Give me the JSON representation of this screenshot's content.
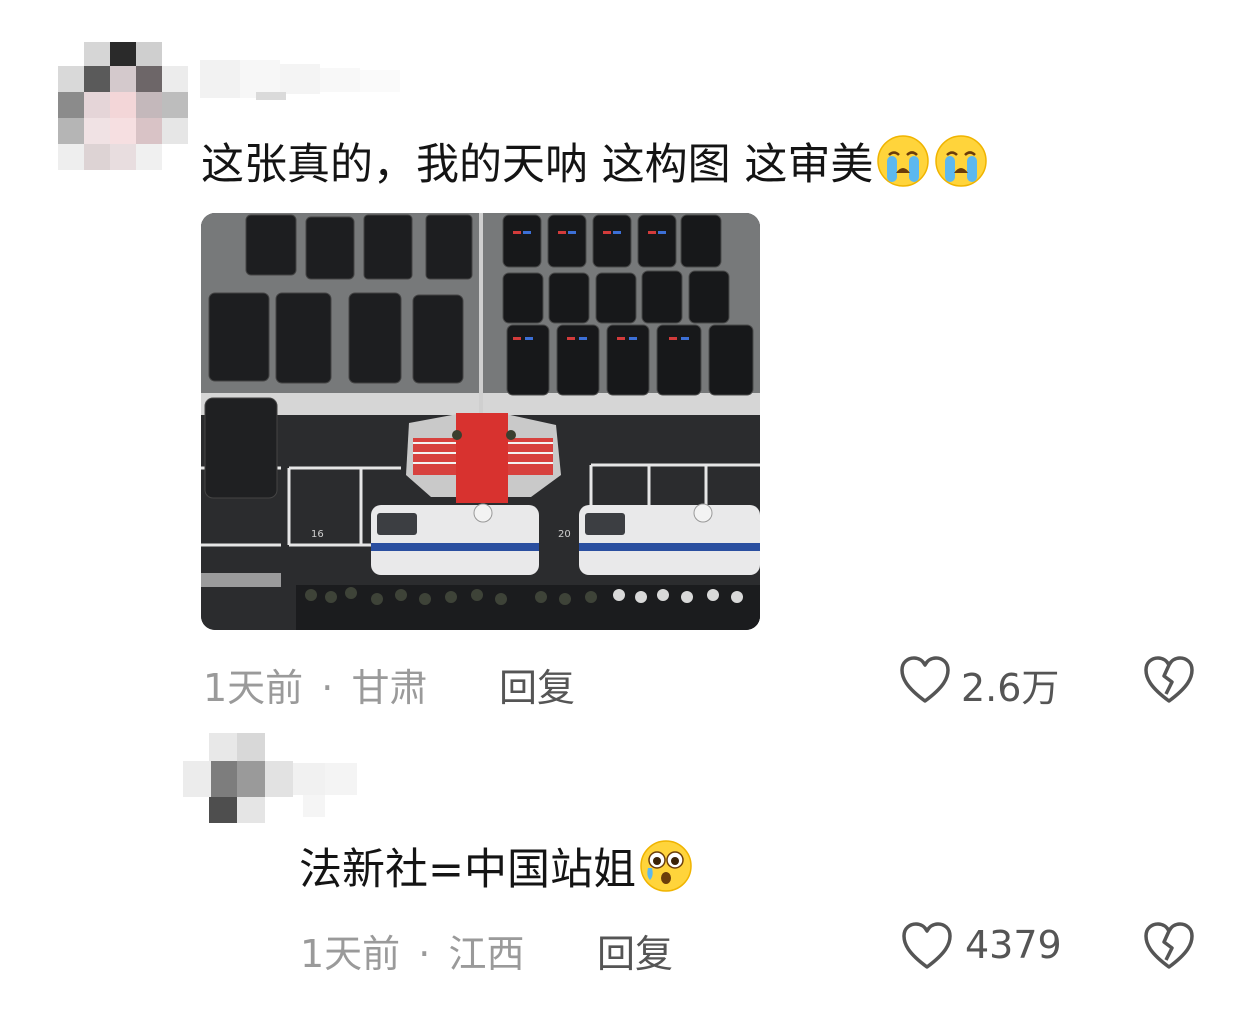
{
  "comment_main": {
    "text": "这张真的，我的天呐 这构图 这审美",
    "emoji": "crying-face-emoji",
    "time": "1天前",
    "separator": "·",
    "location": "甘肃",
    "reply_label": "回复",
    "like_count": "2.6万"
  },
  "comment_reply": {
    "text": "法新社=中国站姐",
    "emoji": "flushed-teary-face-emoji",
    "time": "1天前",
    "separator": "·",
    "location": "江西",
    "reply_label": "回复",
    "like_count": "4379"
  },
  "photo": {
    "spot_numbers": [
      "16",
      "20"
    ]
  },
  "icons": {
    "like": "heart-outline-icon",
    "dislike": "broken-heart-icon"
  },
  "colors": {
    "text_primary": "#141414",
    "text_meta": "#9a9a9a",
    "text_action": "#555555",
    "carpet_red": "#d8322f"
  }
}
